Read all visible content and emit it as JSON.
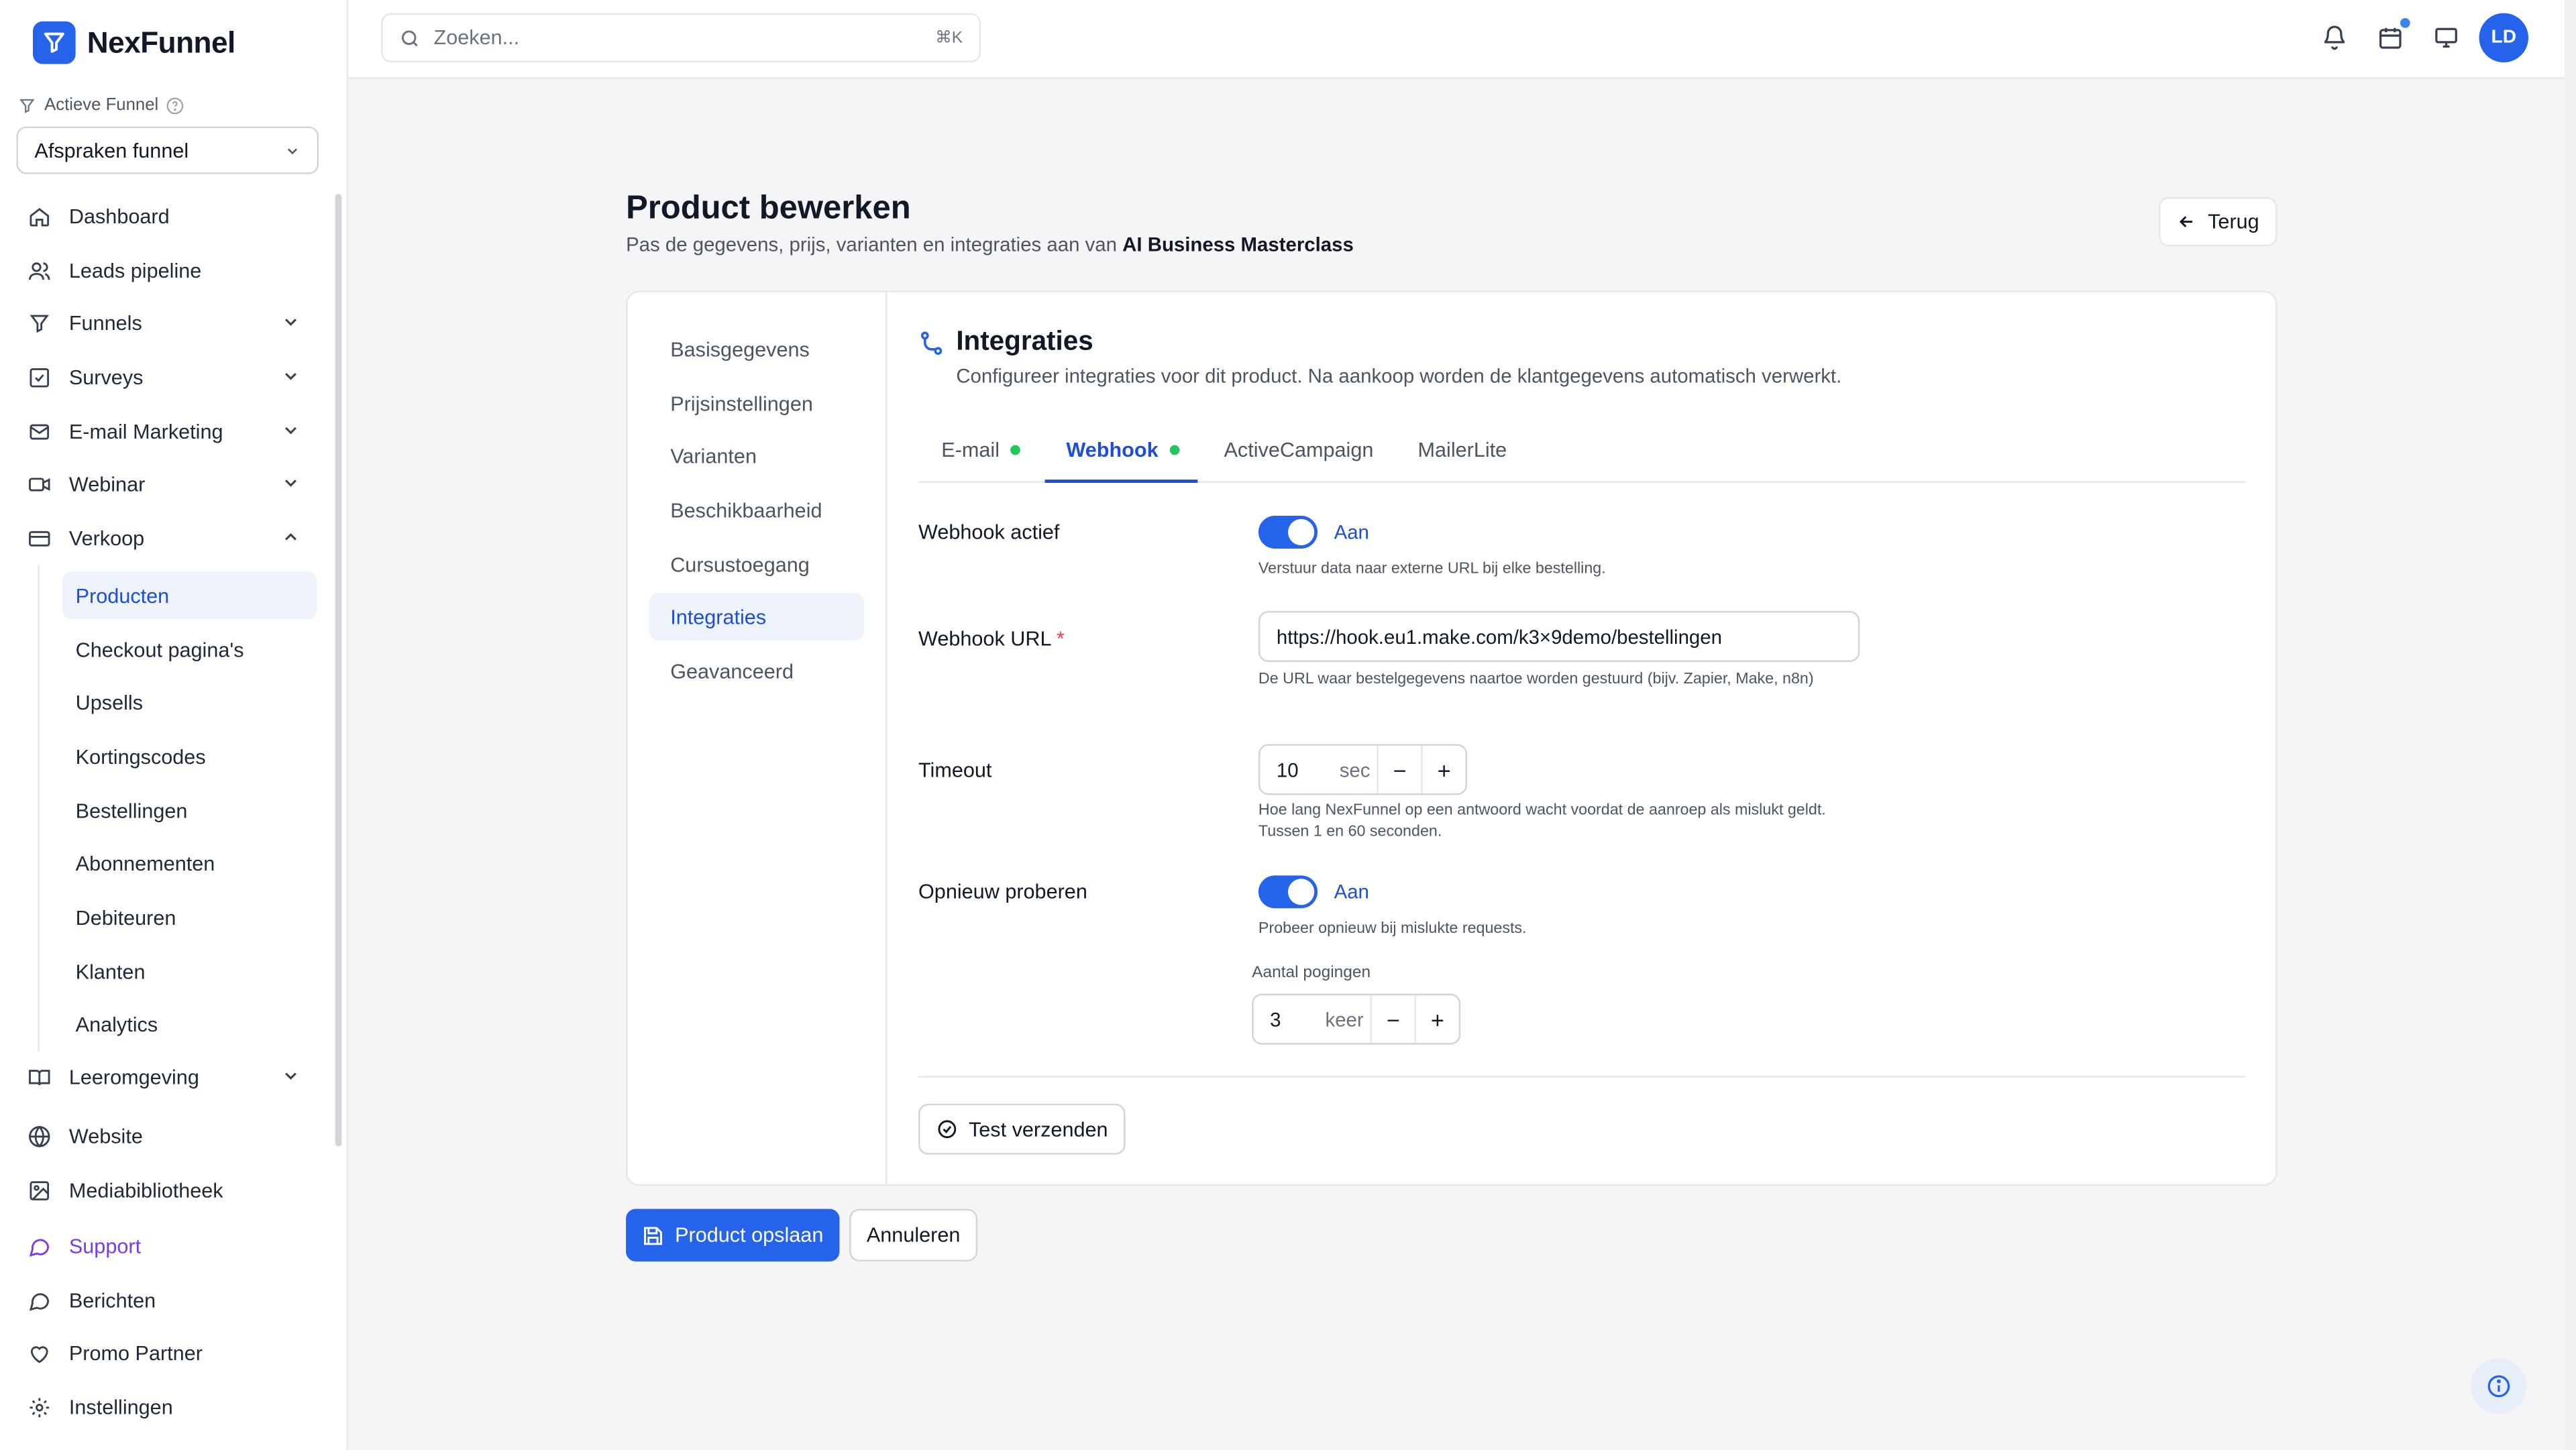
{
  "app": {
    "name": "NexFunnel"
  },
  "sidebar": {
    "funnel_label": "Actieve Funnel",
    "funnel_value": "Afspraken funnel",
    "items": [
      {
        "label": "Dashboard",
        "icon": "home-icon"
      },
      {
        "label": "Leads pipeline",
        "icon": "users-icon"
      },
      {
        "label": "Funnels",
        "icon": "funnel-icon"
      },
      {
        "label": "Surveys",
        "icon": "checkbox-icon"
      },
      {
        "label": "E-mail Marketing",
        "icon": "mail-icon"
      },
      {
        "label": "Webinar",
        "icon": "video-icon"
      },
      {
        "label": "Verkoop",
        "icon": "credit-card-icon"
      },
      {
        "label": "Leeromgeving",
        "icon": "book-icon"
      },
      {
        "label": "Website",
        "icon": "globe-icon"
      },
      {
        "label": "Mediabibliotheek",
        "icon": "image-icon"
      },
      {
        "label": "Support",
        "icon": "chat-icon"
      },
      {
        "label": "Berichten",
        "icon": "message-icon"
      },
      {
        "label": "Promo Partner",
        "icon": "heart-icon"
      },
      {
        "label": "Instellingen",
        "icon": "gear-icon"
      }
    ],
    "sales_sub": [
      "Producten",
      "Checkout pagina's",
      "Upsells",
      "Kortingscodes",
      "Bestellingen",
      "Abonnementen",
      "Debiteuren",
      "Klanten",
      "Analytics"
    ],
    "active_sub": "Producten"
  },
  "topbar": {
    "search_placeholder": "Zoeken...",
    "search_shortcut": "⌘K",
    "avatar_initials": "LD"
  },
  "page": {
    "title": "Product bewerken",
    "subtitle_prefix": "Pas de gegevens, prijs, varianten en integraties aan van",
    "product_name": "AI Business Masterclass",
    "back_label": "Terug"
  },
  "left_nav": [
    "Basisgegevens",
    "Prijsinstellingen",
    "Varianten",
    "Beschikbaarheid",
    "Cursustoegang",
    "Integraties",
    "Geavanceerd"
  ],
  "left_nav_active": "Integraties",
  "section": {
    "title": "Integraties",
    "description": "Configureer integraties voor dit product. Na aankoop worden de klantgegevens automatisch verwerkt."
  },
  "tabs": [
    {
      "label": "E-mail",
      "status": "active"
    },
    {
      "label": "Webhook",
      "status": "active"
    },
    {
      "label": "ActiveCampaign",
      "status": ""
    },
    {
      "label": "MailerLite",
      "status": ""
    }
  ],
  "active_tab": "Webhook",
  "form": {
    "webhook_active_label": "Webhook actief",
    "webhook_active_value": "Aan",
    "webhook_active_help": "Verstuur data naar externe URL bij elke bestelling.",
    "url_label": "Webhook URL",
    "url_required": "*",
    "url_value": "https://hook.eu1.make.com/k3×9demo/bestellingen",
    "url_help": "De URL waar bestelgegevens naartoe worden gestuurd (bijv. Zapier, Make, n8n)",
    "timeout_label": "Timeout",
    "timeout_value": "10",
    "timeout_unit": "sec",
    "timeout_help": "Hoe lang NexFunnel op een antwoord wacht voordat de aanroep als mislukt geldt. Tussen 1 en 60 seconden.",
    "retry_label": "Opnieuw proberen",
    "retry_value": "Aan",
    "retry_help": "Probeer opnieuw bij mislukte requests.",
    "attempts_label": "Aantal pogingen",
    "attempts_value": "3",
    "attempts_unit": "keer",
    "minus": "−",
    "plus": "+"
  },
  "buttons": {
    "test": "Test verzenden",
    "save": "Product opslaan",
    "cancel": "Annuleren"
  },
  "colors": {
    "accent": "#2563eb",
    "success": "#22c55e"
  }
}
